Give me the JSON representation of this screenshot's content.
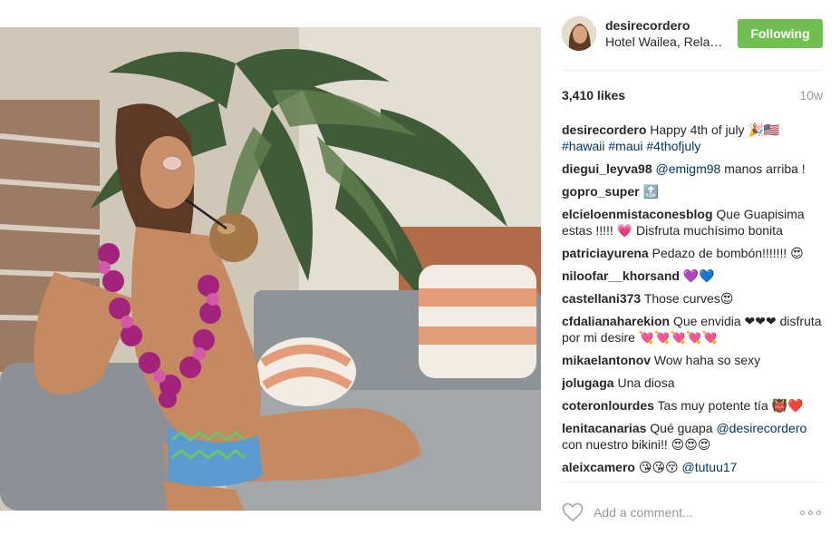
{
  "post": {
    "username": "desirecordero",
    "location": "Hotel Wailea, Relais & Chateaux",
    "follow_label": "Following",
    "likes": "3,410 likes",
    "age": "10w",
    "caption": {
      "user": "desirecordero",
      "text": "Happy 4th of july 🎉🇺🇸",
      "tags": "#hawaii #maui #4thofjuly"
    },
    "comments": [
      {
        "user": "diegui_leyva98",
        "tag": "@emigm98",
        "text": "manos arriba !"
      },
      {
        "user": "gopro_super",
        "text": "🔝"
      },
      {
        "user": "elcieloenmistaconesblog",
        "text": "Que Guapisima estas !!!!! 💗 Disfruta muchísimo bonita"
      },
      {
        "user": "patriciayurena",
        "text": "Pedazo de bombón!!!!!!! 😍"
      },
      {
        "user": "niloofar__khorsand",
        "text": "💜💙"
      },
      {
        "user": "castellani373",
        "text": "Those curves😍"
      },
      {
        "user": "cfdalianaharekion",
        "text": "Que envidia ❤❤❤ disfruta por mi desire 💘💘💘💘💘"
      },
      {
        "user": "mikaelantonov",
        "text": "Wow haha so sexy"
      },
      {
        "user": "jolugaga",
        "text": "Una diosa"
      },
      {
        "user": "coteronlourdes",
        "text": "Tas muy potente tía 👹❤️"
      },
      {
        "user": "lenitacanarias",
        "text": "Qué guapa",
        "tag": "@desirecordero",
        "text2": "con nuestro bikini!! 😍😍😍"
      },
      {
        "user": "aleixcamero",
        "text": "😘😘😚",
        "tag": "@tutuu17"
      }
    ],
    "comment_placeholder": "Add a comment...",
    "icons": {
      "like": "heart-outline-icon",
      "more": "more-options-icon"
    },
    "colors": {
      "follow_button": "#70c050",
      "hashtag": "#003569",
      "muted": "#999999"
    }
  }
}
